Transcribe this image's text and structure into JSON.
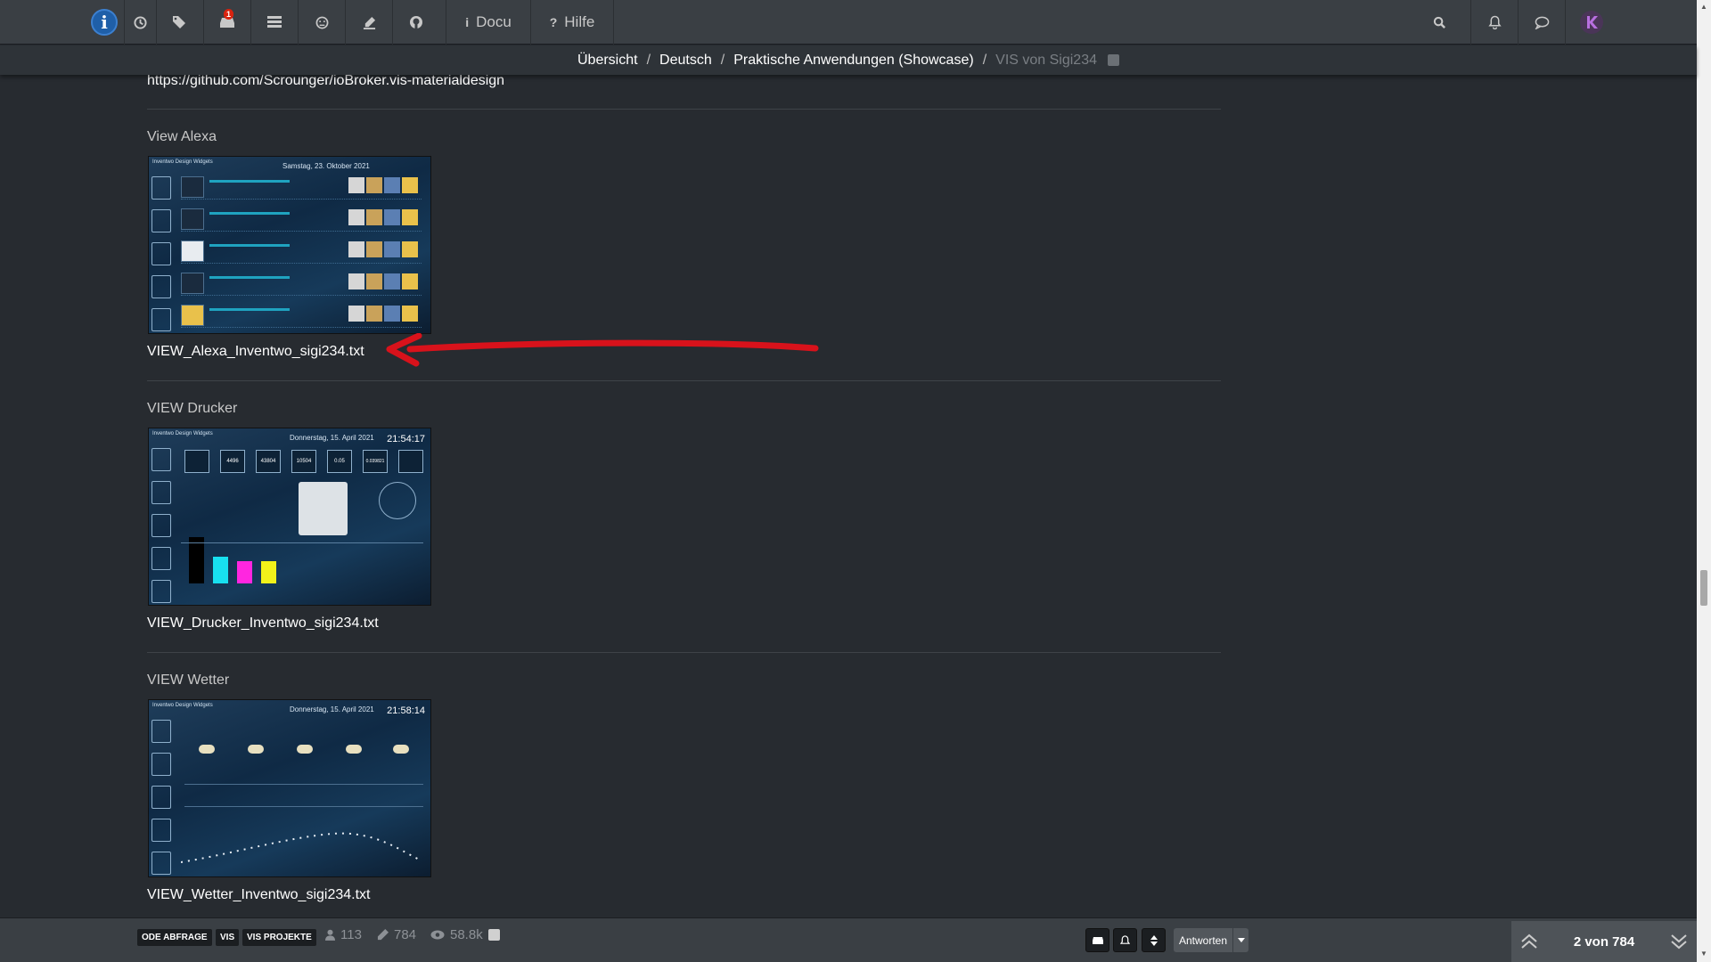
{
  "nav": {
    "logo_letter": "i",
    "notifications_badge": "1",
    "docu_label": "Docu",
    "help_label": "Hilfe"
  },
  "breadcrumb": {
    "items": [
      "Übersicht",
      "Deutsch",
      "Praktische Anwendungen (Showcase)",
      "VIS von Sigi234"
    ],
    "separator": "/"
  },
  "content": {
    "url_text": "https://github.com/Scrounger/ioBroker.vis-materialdesign",
    "sections": [
      {
        "title": "View Alexa",
        "file": "VIEW_Alexa_Inventwo_sigi234.txt",
        "thumb_date": "Samstag, 23. Oktober 2021"
      },
      {
        "title": "VIEW Drucker",
        "file": "VIEW_Drucker_Inventwo_sigi234.txt",
        "thumb_date": "Donnerstag, 15. April 2021",
        "thumb_time": "21:54:17",
        "thumb_values": [
          "4496",
          "43804",
          "10504",
          "0.05",
          "0.039821"
        ]
      },
      {
        "title": "VIEW Wetter",
        "file": "VIEW_Wetter_Inventwo_sigi234.txt",
        "thumb_date": "Donnerstag, 15. April 2021",
        "thumb_time": "21:58:14"
      }
    ],
    "thumb_header": "Inventwo Design Widgets"
  },
  "footer": {
    "tags": [
      "ODE ABFRAGE",
      "VIS",
      "VIS PROJEKTE"
    ],
    "posters": "113",
    "posts": "784",
    "views": "58.8k",
    "reply_label": "Antworten",
    "pager": "2 von 784"
  },
  "colors": {
    "annotation_arrow": "#d8121b",
    "nav_bg": "#3a3f44",
    "page_bg": "#272b30"
  }
}
